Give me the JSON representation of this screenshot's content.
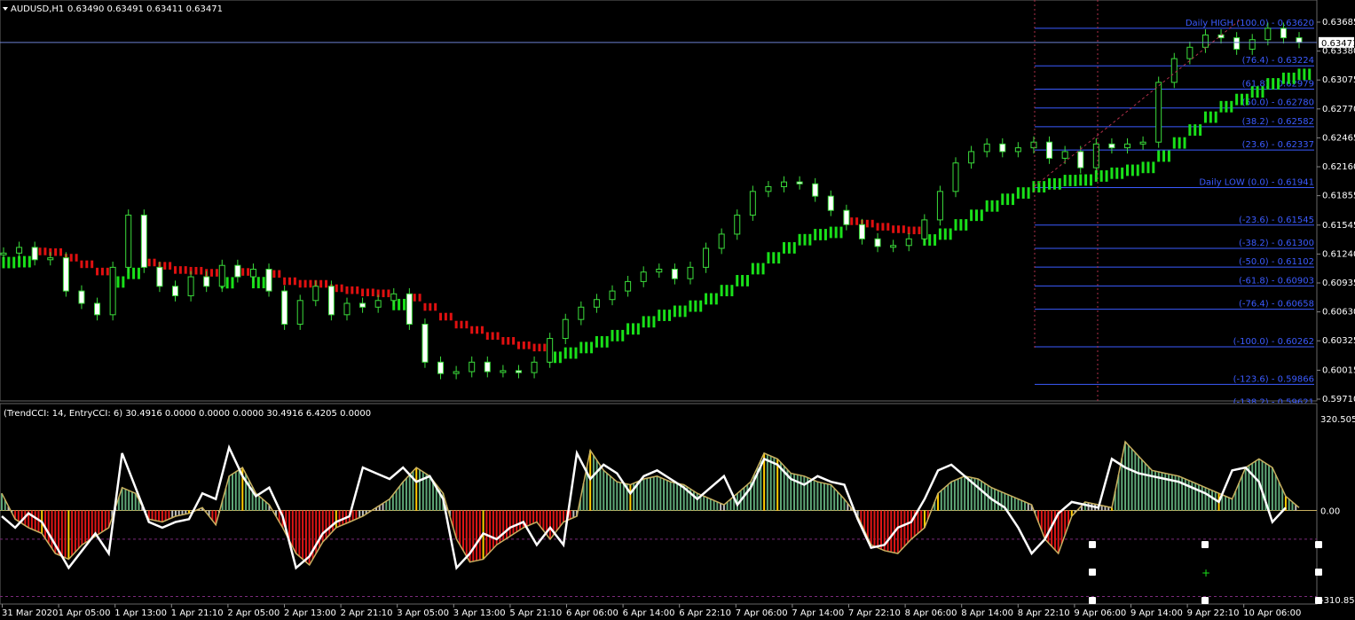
{
  "chart_data": {
    "type": "candlestick",
    "symbol_header": "AUDUSD,H1",
    "ohlc_header": "0.63490 0.63491 0.63411 0.63471",
    "current_price_label": "0.63471",
    "price_ticks": [
      "0.63685",
      "0.63380",
      "0.63075",
      "0.62770",
      "0.62465",
      "0.62160",
      "0.61855",
      "0.61545",
      "0.61240",
      "0.60935",
      "0.60630",
      "0.60325",
      "0.60015",
      "0.59710"
    ],
    "price_range": [
      0.5971,
      0.6375
    ],
    "current_price": 0.63471,
    "time_labels": [
      "31 Mar 2020",
      "1 Apr 05:00",
      "1 Apr 13:00",
      "1 Apr 21:10",
      "2 Apr 05:00",
      "2 Apr 13:00",
      "2 Apr 21:10",
      "3 Apr 05:00",
      "3 Apr 13:00",
      "5 Apr 21:10",
      "6 Apr 06:00",
      "6 Apr 14:00",
      "6 Apr 22:10",
      "7 Apr 06:00",
      "7 Apr 14:00",
      "7 Apr 22:10",
      "8 Apr 06:00",
      "8 Apr 14:00",
      "8 Apr 22:10",
      "9 Apr 06:00",
      "9 Apr 14:00",
      "9 Apr 22:10",
      "10 Apr 06:00"
    ],
    "close_path": [
      0.6125,
      0.6131,
      0.6118,
      0.612,
      0.6085,
      0.6072,
      0.606,
      0.611,
      0.6165,
      0.611,
      0.609,
      0.608,
      0.61,
      0.609,
      0.6112,
      0.61,
      0.6108,
      0.6085,
      0.605,
      0.6075,
      0.609,
      0.606,
      0.6072,
      0.6068,
      0.6075,
      0.6082,
      0.605,
      0.601,
      0.5998,
      0.6,
      0.601,
      0.6,
      0.6001,
      0.5999,
      0.601,
      0.6035,
      0.6055,
      0.6068,
      0.6076,
      0.6085,
      0.6095,
      0.6105,
      0.6108,
      0.6098,
      0.611,
      0.613,
      0.6145,
      0.6165,
      0.619,
      0.6195,
      0.62,
      0.6198,
      0.6185,
      0.617,
      0.6155,
      0.614,
      0.6132,
      0.6133,
      0.614,
      0.616,
      0.619,
      0.622,
      0.6232,
      0.624,
      0.6232,
      0.6236,
      0.6242,
      0.6225,
      0.6232,
      0.6215,
      0.624,
      0.6236,
      0.624,
      0.6242,
      0.6305,
      0.633,
      0.6342,
      0.6355,
      0.6352,
      0.634,
      0.635,
      0.6362,
      0.6352,
      0.6347
    ],
    "fibonacci": {
      "levels": [
        {
          "label": "Daily HIGH (100.0) -  0.63620",
          "price": 0.6362
        },
        {
          "label": "(76.4) -  0.63224",
          "price": 0.63224
        },
        {
          "label": "(61.8) -  0.62979",
          "price": 0.62979
        },
        {
          "label": "(50.0) -  0.62780",
          "price": 0.6278
        },
        {
          "label": "(38.2) -  0.62582",
          "price": 0.62582
        },
        {
          "label": "(23.6) -  0.62337",
          "price": 0.62337
        },
        {
          "label": "Daily LOW (0.0) -  0.61941",
          "price": 0.61941
        },
        {
          "label": "(-23.6) -  0.61545",
          "price": 0.61545
        },
        {
          "label": "(-38.2) -  0.61300",
          "price": 0.613
        },
        {
          "label": "(-50.0) -  0.61102",
          "price": 0.61102
        },
        {
          "label": "(-61.8) -  0.60903",
          "price": 0.60903
        },
        {
          "label": "(-76.4) -  0.60658",
          "price": 0.60658
        },
        {
          "label": "(-100.0) -  0.60262",
          "price": 0.60262
        },
        {
          "label": "(-123.6) -  0.59866",
          "price": 0.59866
        },
        {
          "label": "(-138.2) -  0.59621",
          "price": 0.59621
        }
      ]
    },
    "indicator": {
      "header": "(TrendCCI: 14, EntryCCI: 6)  30.4916  0.0000  0.0000  0.0000  30.4916  6.4205  0.0000",
      "ticks": [
        "320.5058",
        "0.00",
        "-310.8532"
      ],
      "range": [
        -310.8532,
        320.5058
      ],
      "trend_cci": [
        60,
        -30,
        -60,
        -80,
        -150,
        -170,
        -120,
        -90,
        -60,
        80,
        60,
        -30,
        -40,
        -20,
        -10,
        10,
        -50,
        120,
        150,
        60,
        20,
        -60,
        -150,
        -190,
        -110,
        -60,
        -40,
        -20,
        10,
        40,
        100,
        150,
        120,
        60,
        -100,
        -180,
        -170,
        -120,
        -90,
        -60,
        -40,
        -100,
        -40,
        -20,
        210,
        140,
        100,
        90,
        110,
        120,
        100,
        90,
        60,
        40,
        20,
        60,
        100,
        200,
        180,
        130,
        120,
        100,
        90,
        40,
        -20,
        -120,
        -140,
        -150,
        -100,
        -60,
        60,
        100,
        120,
        110,
        80,
        60,
        40,
        20,
        -100,
        -150,
        -20,
        30,
        20,
        10,
        240,
        190,
        140,
        130,
        120,
        100,
        80,
        60,
        40,
        150,
        180,
        150,
        50,
        10
      ],
      "entry_cci": [
        -20,
        -60,
        -10,
        -40,
        -120,
        -200,
        -140,
        -80,
        -150,
        200,
        80,
        -40,
        -60,
        -40,
        -30,
        60,
        40,
        220,
        120,
        50,
        80,
        -20,
        -200,
        -160,
        -80,
        -40,
        -20,
        150,
        130,
        110,
        150,
        100,
        120,
        40,
        -200,
        -150,
        -80,
        -100,
        -60,
        -40,
        -120,
        -60,
        -120,
        200,
        110,
        160,
        130,
        60,
        120,
        140,
        110,
        80,
        40,
        80,
        120,
        20,
        80,
        180,
        160,
        110,
        90,
        120,
        100,
        90,
        -30,
        -130,
        -120,
        -60,
        -40,
        40,
        140,
        160,
        120,
        80,
        40,
        10,
        -60,
        -150,
        -100,
        -10,
        30,
        20,
        10,
        180,
        150,
        130,
        120,
        110,
        100,
        80,
        60,
        30,
        140,
        150,
        100,
        -40,
        10
      ]
    }
  }
}
